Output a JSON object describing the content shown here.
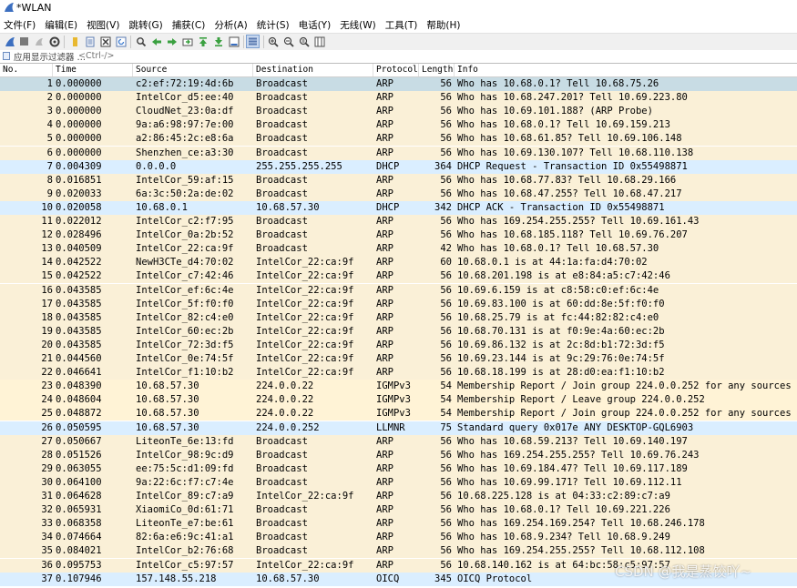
{
  "window": {
    "title": "*WLAN"
  },
  "menu": [
    "文件(F)",
    "编辑(E)",
    "视图(V)",
    "跳转(G)",
    "捕获(C)",
    "分析(A)",
    "统计(S)",
    "电话(Y)",
    "无线(W)",
    "工具(T)",
    "帮助(H)"
  ],
  "toolbar": {
    "buttons": [
      {
        "icon": "shark-fin-start-icon",
        "color": "#3c6fc0"
      },
      {
        "icon": "stop-square-icon",
        "color": "#7a7a7a"
      },
      {
        "icon": "restart-fin-icon",
        "color": "#b0b0b0"
      },
      {
        "icon": "capture-options-gear-icon",
        "color": "#505050"
      },
      {
        "icon": "open-folder-icon",
        "color": "#e8b830"
      },
      {
        "icon": "file-icon",
        "color": "#5a7ab0"
      },
      {
        "icon": "close-file-icon",
        "color": "#404040"
      },
      {
        "icon": "reload-icon",
        "color": "#3a7ad0"
      },
      {
        "icon": "find-magnifier-icon",
        "color": "#404040"
      },
      {
        "icon": "go-back-arrow-icon",
        "color": "#3aa040"
      },
      {
        "icon": "go-forward-arrow-icon",
        "color": "#3aa040"
      },
      {
        "icon": "go-to-packet-icon",
        "color": "#3aa040"
      },
      {
        "icon": "go-first-icon",
        "color": "#3aa040"
      },
      {
        "icon": "go-last-icon",
        "color": "#3aa040"
      },
      {
        "icon": "autoscroll-icon",
        "color": "#505050"
      },
      {
        "icon": "colorize-icon",
        "color": "#5a7ab0"
      },
      {
        "icon": "zoom-in-icon",
        "color": "#404040"
      },
      {
        "icon": "zoom-out-icon",
        "color": "#404040"
      },
      {
        "icon": "zoom-normal-icon",
        "color": "#404040"
      },
      {
        "icon": "resize-columns-icon",
        "color": "#505050"
      }
    ]
  },
  "filter": {
    "label": "应用显示过滤器 …",
    "placeholder": "<Ctrl-/>"
  },
  "columns": [
    "No.",
    "Time",
    "Source",
    "Destination",
    "Protocol",
    "Length",
    "Info"
  ],
  "colors": {
    "arp": "#faf0d7",
    "udp": "#daeeff",
    "igmp": "#fff3d6",
    "selected": "#c8dce4"
  },
  "packets": [
    {
      "no": "1",
      "time": "0.000000",
      "src": "c2:ef:72:19:4d:6b",
      "dst": "Broadcast",
      "proto": "ARP",
      "len": "56",
      "info": "Who has 10.68.0.1? Tell 10.68.75.26",
      "cls": "selected"
    },
    {
      "no": "2",
      "time": "0.000000",
      "src": "IntelCor_d5:ee:40",
      "dst": "Broadcast",
      "proto": "ARP",
      "len": "56",
      "info": "Who has 10.68.247.201? Tell 10.69.223.80",
      "cls": "arp"
    },
    {
      "no": "3",
      "time": "0.000000",
      "src": "CloudNet_23:0a:df",
      "dst": "Broadcast",
      "proto": "ARP",
      "len": "56",
      "info": "Who has 10.69.101.188? (ARP Probe)",
      "cls": "arp"
    },
    {
      "no": "4",
      "time": "0.000000",
      "src": "9a:a6:98:97:7e:00",
      "dst": "Broadcast",
      "proto": "ARP",
      "len": "56",
      "info": "Who has 10.68.0.1? Tell 10.69.159.213",
      "cls": "arp"
    },
    {
      "no": "5",
      "time": "0.000000",
      "src": "a2:86:45:2c:e8:6a",
      "dst": "Broadcast",
      "proto": "ARP",
      "len": "56",
      "info": "Who has 10.68.61.85? Tell 10.69.106.148",
      "cls": "arp"
    },
    {
      "no": "6",
      "time": "0.000000",
      "src": "Shenzhen_ce:a3:30",
      "dst": "Broadcast",
      "proto": "ARP",
      "len": "56",
      "info": "Who has 10.69.130.107? Tell 10.68.110.138",
      "cls": "arp"
    },
    {
      "no": "7",
      "time": "0.004309",
      "src": "0.0.0.0",
      "dst": "255.255.255.255",
      "proto": "DHCP",
      "len": "364",
      "info": "DHCP Request  - Transaction ID 0x55498871",
      "cls": "udp"
    },
    {
      "no": "8",
      "time": "0.016851",
      "src": "IntelCor_59:af:15",
      "dst": "Broadcast",
      "proto": "ARP",
      "len": "56",
      "info": "Who has 10.68.77.83? Tell 10.68.29.166",
      "cls": "arp"
    },
    {
      "no": "9",
      "time": "0.020033",
      "src": "6a:3c:50:2a:de:02",
      "dst": "Broadcast",
      "proto": "ARP",
      "len": "56",
      "info": "Who has 10.68.47.255? Tell 10.68.47.217",
      "cls": "arp"
    },
    {
      "no": "10",
      "time": "0.020058",
      "src": "10.68.0.1",
      "dst": "10.68.57.30",
      "proto": "DHCP",
      "len": "342",
      "info": "DHCP ACK      - Transaction ID 0x55498871",
      "cls": "udp"
    },
    {
      "no": "11",
      "time": "0.022012",
      "src": "IntelCor_c2:f7:95",
      "dst": "Broadcast",
      "proto": "ARP",
      "len": "56",
      "info": "Who has 169.254.255.255? Tell 10.69.161.43",
      "cls": "arp"
    },
    {
      "no": "12",
      "time": "0.028496",
      "src": "IntelCor_0a:2b:52",
      "dst": "Broadcast",
      "proto": "ARP",
      "len": "56",
      "info": "Who has 10.68.185.118? Tell 10.69.76.207",
      "cls": "arp"
    },
    {
      "no": "13",
      "time": "0.040509",
      "src": "IntelCor_22:ca:9f",
      "dst": "Broadcast",
      "proto": "ARP",
      "len": "42",
      "info": "Who has 10.68.0.1? Tell 10.68.57.30",
      "cls": "arp"
    },
    {
      "no": "14",
      "time": "0.042522",
      "src": "NewH3CTe_d4:70:02",
      "dst": "IntelCor_22:ca:9f",
      "proto": "ARP",
      "len": "60",
      "info": "10.68.0.1 is at 44:1a:fa:d4:70:02",
      "cls": "arp"
    },
    {
      "no": "15",
      "time": "0.042522",
      "src": "IntelCor_c7:42:46",
      "dst": "IntelCor_22:ca:9f",
      "proto": "ARP",
      "len": "56",
      "info": "10.68.201.198 is at e8:84:a5:c7:42:46",
      "cls": "arp"
    },
    {
      "no": "16",
      "time": "0.043585",
      "src": "IntelCor_ef:6c:4e",
      "dst": "IntelCor_22:ca:9f",
      "proto": "ARP",
      "len": "56",
      "info": "10.69.6.159 is at c8:58:c0:ef:6c:4e",
      "cls": "arp"
    },
    {
      "no": "17",
      "time": "0.043585",
      "src": "IntelCor_5f:f0:f0",
      "dst": "IntelCor_22:ca:9f",
      "proto": "ARP",
      "len": "56",
      "info": "10.69.83.100 is at 60:dd:8e:5f:f0:f0",
      "cls": "arp"
    },
    {
      "no": "18",
      "time": "0.043585",
      "src": "IntelCor_82:c4:e0",
      "dst": "IntelCor_22:ca:9f",
      "proto": "ARP",
      "len": "56",
      "info": "10.68.25.79 is at fc:44:82:82:c4:e0",
      "cls": "arp"
    },
    {
      "no": "19",
      "time": "0.043585",
      "src": "IntelCor_60:ec:2b",
      "dst": "IntelCor_22:ca:9f",
      "proto": "ARP",
      "len": "56",
      "info": "10.68.70.131 is at f0:9e:4a:60:ec:2b",
      "cls": "arp"
    },
    {
      "no": "20",
      "time": "0.043585",
      "src": "IntelCor_72:3d:f5",
      "dst": "IntelCor_22:ca:9f",
      "proto": "ARP",
      "len": "56",
      "info": "10.69.86.132 is at 2c:8d:b1:72:3d:f5",
      "cls": "arp"
    },
    {
      "no": "21",
      "time": "0.044560",
      "src": "IntelCor_0e:74:5f",
      "dst": "IntelCor_22:ca:9f",
      "proto": "ARP",
      "len": "56",
      "info": "10.69.23.144 is at 9c:29:76:0e:74:5f",
      "cls": "arp"
    },
    {
      "no": "22",
      "time": "0.046641",
      "src": "IntelCor_f1:10:b2",
      "dst": "IntelCor_22:ca:9f",
      "proto": "ARP",
      "len": "56",
      "info": "10.68.18.199 is at 28:d0:ea:f1:10:b2",
      "cls": "arp"
    },
    {
      "no": "23",
      "time": "0.048390",
      "src": "10.68.57.30",
      "dst": "224.0.0.22",
      "proto": "IGMPv3",
      "len": "54",
      "info": "Membership Report / Join group 224.0.0.252 for any sources",
      "cls": "igmp"
    },
    {
      "no": "24",
      "time": "0.048604",
      "src": "10.68.57.30",
      "dst": "224.0.0.22",
      "proto": "IGMPv3",
      "len": "54",
      "info": "Membership Report / Leave group 224.0.0.252",
      "cls": "igmp"
    },
    {
      "no": "25",
      "time": "0.048872",
      "src": "10.68.57.30",
      "dst": "224.0.0.22",
      "proto": "IGMPv3",
      "len": "54",
      "info": "Membership Report / Join group 224.0.0.252 for any sources",
      "cls": "igmp"
    },
    {
      "no": "26",
      "time": "0.050595",
      "src": "10.68.57.30",
      "dst": "224.0.0.252",
      "proto": "LLMNR",
      "len": "75",
      "info": "Standard query 0x017e ANY DESKTOP-GQL6903",
      "cls": "udp"
    },
    {
      "no": "27",
      "time": "0.050667",
      "src": "LiteonTe_6e:13:fd",
      "dst": "Broadcast",
      "proto": "ARP",
      "len": "56",
      "info": "Who has 10.68.59.213? Tell 10.69.140.197",
      "cls": "arp"
    },
    {
      "no": "28",
      "time": "0.051526",
      "src": "IntelCor_98:9c:d9",
      "dst": "Broadcast",
      "proto": "ARP",
      "len": "56",
      "info": "Who has 169.254.255.255? Tell 10.69.76.243",
      "cls": "arp"
    },
    {
      "no": "29",
      "time": "0.063055",
      "src": "ee:75:5c:d1:09:fd",
      "dst": "Broadcast",
      "proto": "ARP",
      "len": "56",
      "info": "Who has 10.69.184.47? Tell 10.69.117.189",
      "cls": "arp"
    },
    {
      "no": "30",
      "time": "0.064100",
      "src": "9a:22:6c:f7:c7:4e",
      "dst": "Broadcast",
      "proto": "ARP",
      "len": "56",
      "info": "Who has 10.69.99.171? Tell 10.69.112.11",
      "cls": "arp"
    },
    {
      "no": "31",
      "time": "0.064628",
      "src": "IntelCor_89:c7:a9",
      "dst": "IntelCor_22:ca:9f",
      "proto": "ARP",
      "len": "56",
      "info": "10.68.225.128 is at 04:33:c2:89:c7:a9",
      "cls": "arp"
    },
    {
      "no": "32",
      "time": "0.065931",
      "src": "XiaomiCo_0d:61:71",
      "dst": "Broadcast",
      "proto": "ARP",
      "len": "56",
      "info": "Who has 10.68.0.1? Tell 10.69.221.226",
      "cls": "arp"
    },
    {
      "no": "33",
      "time": "0.068358",
      "src": "LiteonTe_e7:be:61",
      "dst": "Broadcast",
      "proto": "ARP",
      "len": "56",
      "info": "Who has 169.254.169.254? Tell 10.68.246.178",
      "cls": "arp"
    },
    {
      "no": "34",
      "time": "0.074664",
      "src": "82:6a:e6:9c:41:a1",
      "dst": "Broadcast",
      "proto": "ARP",
      "len": "56",
      "info": "Who has 10.68.9.234? Tell 10.68.9.249",
      "cls": "arp"
    },
    {
      "no": "35",
      "time": "0.084021",
      "src": "IntelCor_b2:76:68",
      "dst": "Broadcast",
      "proto": "ARP",
      "len": "56",
      "info": "Who has 169.254.255.255? Tell 10.68.112.108",
      "cls": "arp"
    },
    {
      "no": "36",
      "time": "0.095753",
      "src": "IntelCor_c5:97:57",
      "dst": "IntelCor_22:ca:9f",
      "proto": "ARP",
      "len": "56",
      "info": "10.68.140.162 is at 64:bc:58:c5:97:57",
      "cls": "arp"
    },
    {
      "no": "37",
      "time": "0.107946",
      "src": "157.148.55.218",
      "dst": "10.68.57.30",
      "proto": "OICQ",
      "len": "345",
      "info": "OICQ Protocol",
      "cls": "udp"
    }
  ],
  "watermark": "CSDN @我是蒸饺吖~"
}
